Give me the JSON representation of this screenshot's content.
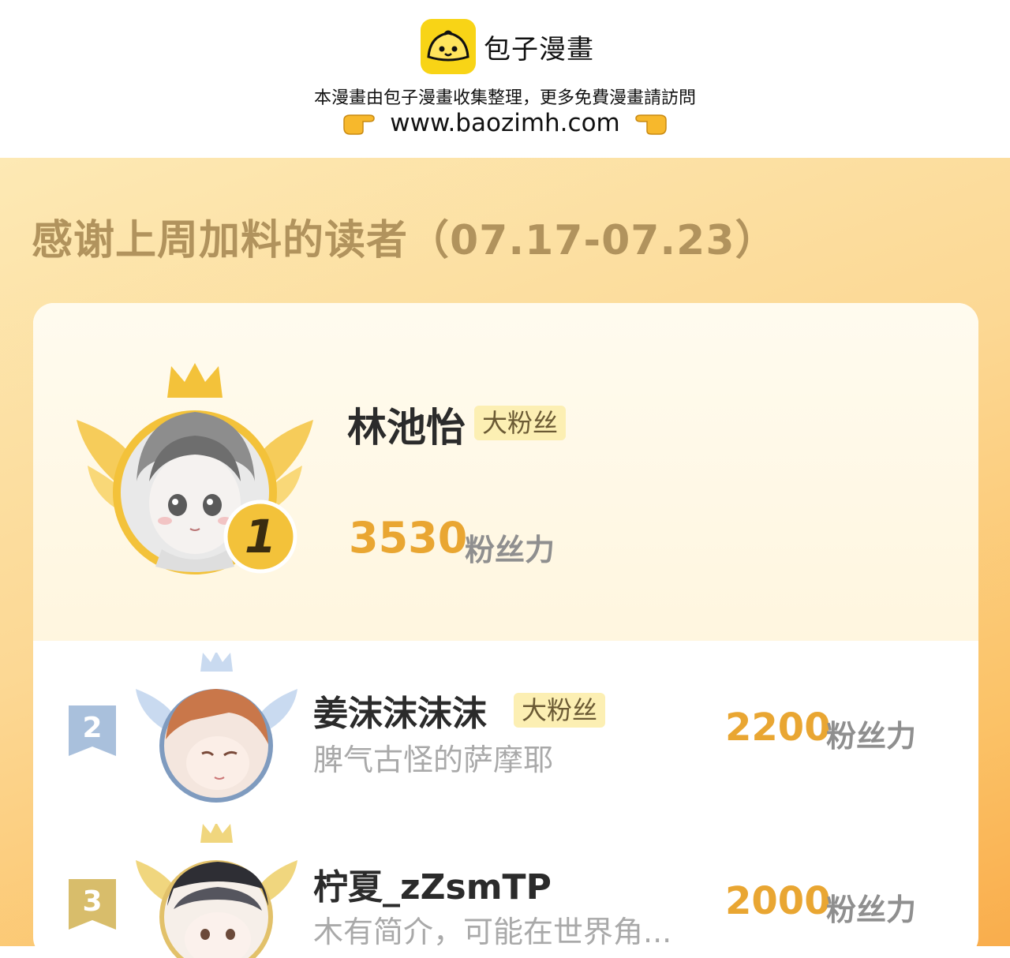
{
  "watermark": {
    "brand": "包子漫畫",
    "notice": "本漫畫由包子漫畫收集整理，更多免費漫畫請訪問",
    "url": "www.baozimh.com"
  },
  "poster": {
    "title": "感谢上周加料的读者（07.17-07.23）"
  },
  "ranking": {
    "first": {
      "rank": "1",
      "name": "林池怡",
      "badge": "大粉丝",
      "score": "3530",
      "unit": "粉丝力"
    },
    "rows": [
      {
        "rank": "2",
        "name": "姜沫沫沫沫",
        "badge": "大粉丝",
        "bio": "脾气古怪的萨摩耶",
        "score": "2200",
        "unit": "粉丝力"
      },
      {
        "rank": "3",
        "name": "柠夏_zZsmTP",
        "bio": "木有简介，可能在世界角...",
        "score": "2000",
        "unit": "粉丝力"
      }
    ]
  },
  "colors": {
    "accent": "#e9a632",
    "gold": "#f3c23a",
    "silver": "#a9c0dc",
    "bronze": "#d8bd6b"
  }
}
